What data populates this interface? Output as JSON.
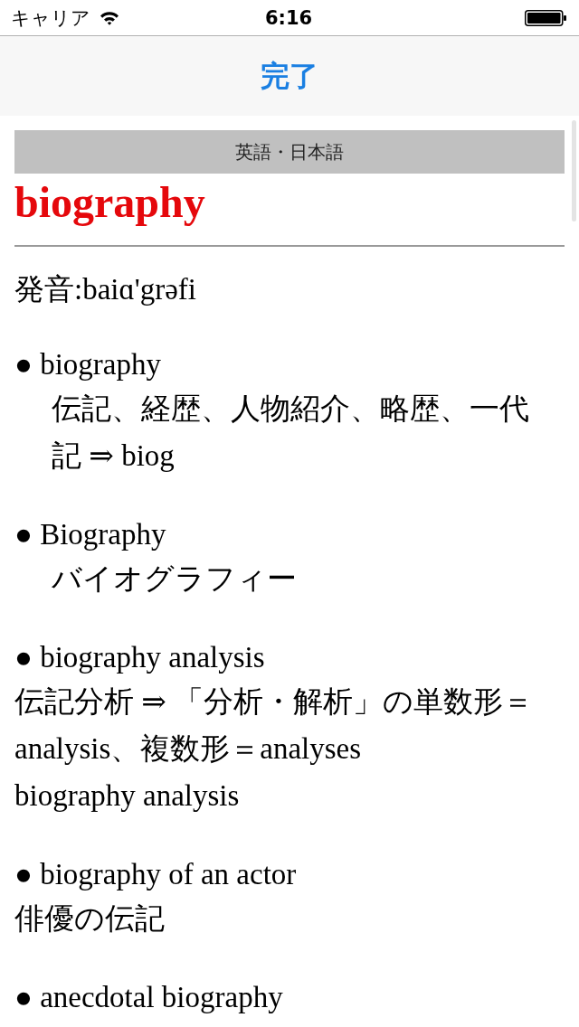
{
  "status_bar": {
    "carrier": "キャリア",
    "time": "6:16"
  },
  "nav_bar": {
    "done_button": "完了"
  },
  "dictionary_label": "英語・日本語",
  "headword": "biography",
  "pronunciation": "発音:baiɑ'grəfi",
  "entries": [
    {
      "term": "● biography",
      "kind": "indented",
      "definitions": [
        "伝記、経歴、人物紹介、略歴、一代記 ⇒ biog"
      ]
    },
    {
      "term": "● Biography",
      "kind": "indented",
      "definitions": [
        "バイオグラフィー"
      ]
    },
    {
      "term": "● biography analysis",
      "kind": "plain",
      "definitions": [
        "伝記分析 ⇒ 「分析・解析」の単数形＝analysis、複数形＝analyses",
        "biography analysis"
      ]
    },
    {
      "term": "● biography of an actor",
      "kind": "plain",
      "definitions": [
        "俳優の伝記"
      ]
    },
    {
      "term": "● anecdotal biography"
    }
  ]
}
